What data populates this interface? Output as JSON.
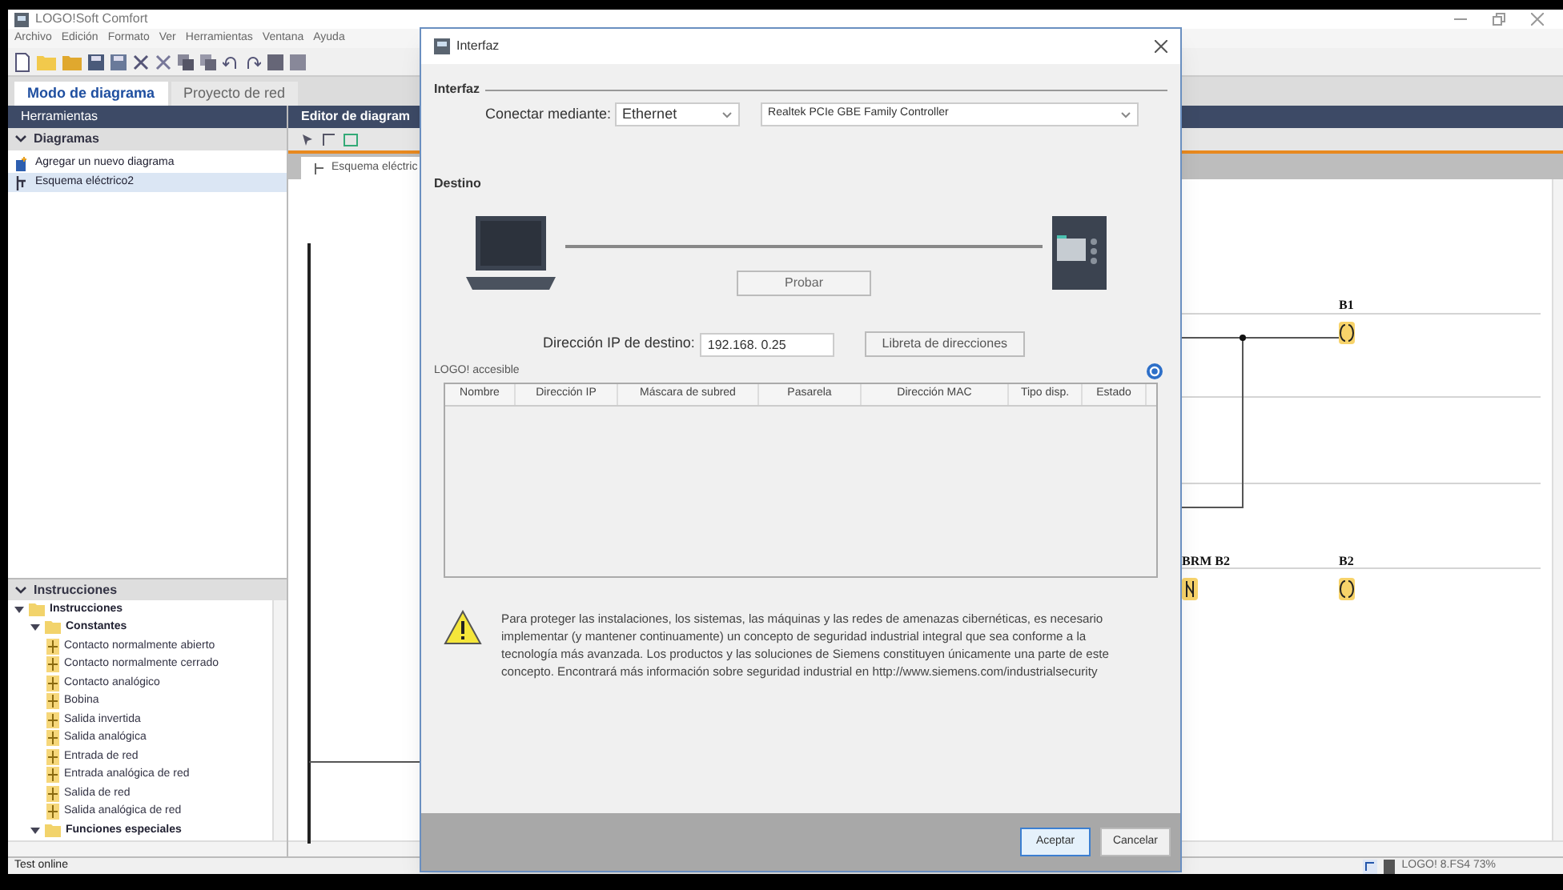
{
  "window": {
    "title": "LOGO!Soft Comfort"
  },
  "menu": [
    "Archivo",
    "Edición",
    "Formato",
    "Ver",
    "Herramientas",
    "Ventana",
    "Ayuda"
  ],
  "mode_tabs": [
    {
      "label": "Modo de diagrama",
      "selected": true
    },
    {
      "label": "Proyecto de red",
      "selected": false
    }
  ],
  "tools_panel": {
    "title": "Herramientas",
    "diagrams": {
      "title": "Diagramas",
      "expanded": true,
      "items": [
        {
          "label": "Agregar un nuevo diagrama",
          "kind": "add",
          "selected": false
        },
        {
          "label": "Esquema eléctrico2",
          "kind": "diagram",
          "selected": true
        }
      ]
    },
    "instructions": {
      "title": "Instrucciones",
      "expanded": true,
      "tree": [
        {
          "label": "Instrucciones",
          "kind": "folder",
          "expanded": true,
          "children": [
            {
              "label": "Constantes",
              "kind": "folder",
              "expanded": true,
              "children": [
                {
                  "label": "Contacto normalmente abierto",
                  "kind": "leaf"
                },
                {
                  "label": "Contacto normalmente cerrado",
                  "kind": "leaf"
                },
                {
                  "label": "Contacto analógico",
                  "kind": "leaf"
                },
                {
                  "label": "Bobina",
                  "kind": "leaf"
                },
                {
                  "label": "Salida invertida",
                  "kind": "leaf"
                },
                {
                  "label": "Salida analógica",
                  "kind": "leaf"
                },
                {
                  "label": "Entrada de red",
                  "kind": "leaf"
                },
                {
                  "label": "Entrada analógica de red",
                  "kind": "leaf"
                },
                {
                  "label": "Salida de red",
                  "kind": "leaf"
                },
                {
                  "label": "Salida analógica de red",
                  "kind": "leaf"
                }
              ]
            },
            {
              "label": "Funciones especiales",
              "kind": "folder",
              "expanded": true
            }
          ]
        }
      ]
    }
  },
  "editor": {
    "title": "Editor de diagram",
    "tab": "Esquema eléctric",
    "blocks": [
      {
        "label": "B1",
        "kind": "coil"
      },
      {
        "label": "BRM B2",
        "kind": "relay"
      },
      {
        "label": "B2",
        "kind": "coil"
      }
    ]
  },
  "dialog": {
    "title": "Interfaz",
    "interface_heading": "Interfaz",
    "connect_label": "Conectar mediante:",
    "connect_value": "Ethernet",
    "adapter_value": "Realtek PCIe GBE Family Controller",
    "target_heading": "Destino",
    "test_button": "Probar",
    "ip_label": "Dirección IP de destino:",
    "ip_value": "192.168. 0.25",
    "address_book_button": "Libreta de direcciones",
    "accessible_label": "LOGO! accesible",
    "table": {
      "columns": [
        "Nombre",
        "Dirección IP",
        "Máscara de subred",
        "Pasarela",
        "Dirección MAC",
        "Tipo disp.",
        "Estado"
      ]
    },
    "warning": "Para proteger las instalaciones, los sistemas, las máquinas y las redes de amenazas cibernéticas, es necesario implementar (y mantener continuamente) un concepto de seguridad industrial integral que sea conforme a la tecnología más avanzada. Los productos y las soluciones de Siemens constituyen únicamente una parte de este concepto. Encontrará más información sobre seguridad industrial en http://www.siemens.com/industrialsecurity",
    "buttons": [
      {
        "label": "Aceptar",
        "selected": true
      },
      {
        "label": "Cancelar",
        "selected": false
      }
    ]
  },
  "status_bar": {
    "left": "Test online",
    "right": "LOGO! 8.FS4 73%"
  }
}
